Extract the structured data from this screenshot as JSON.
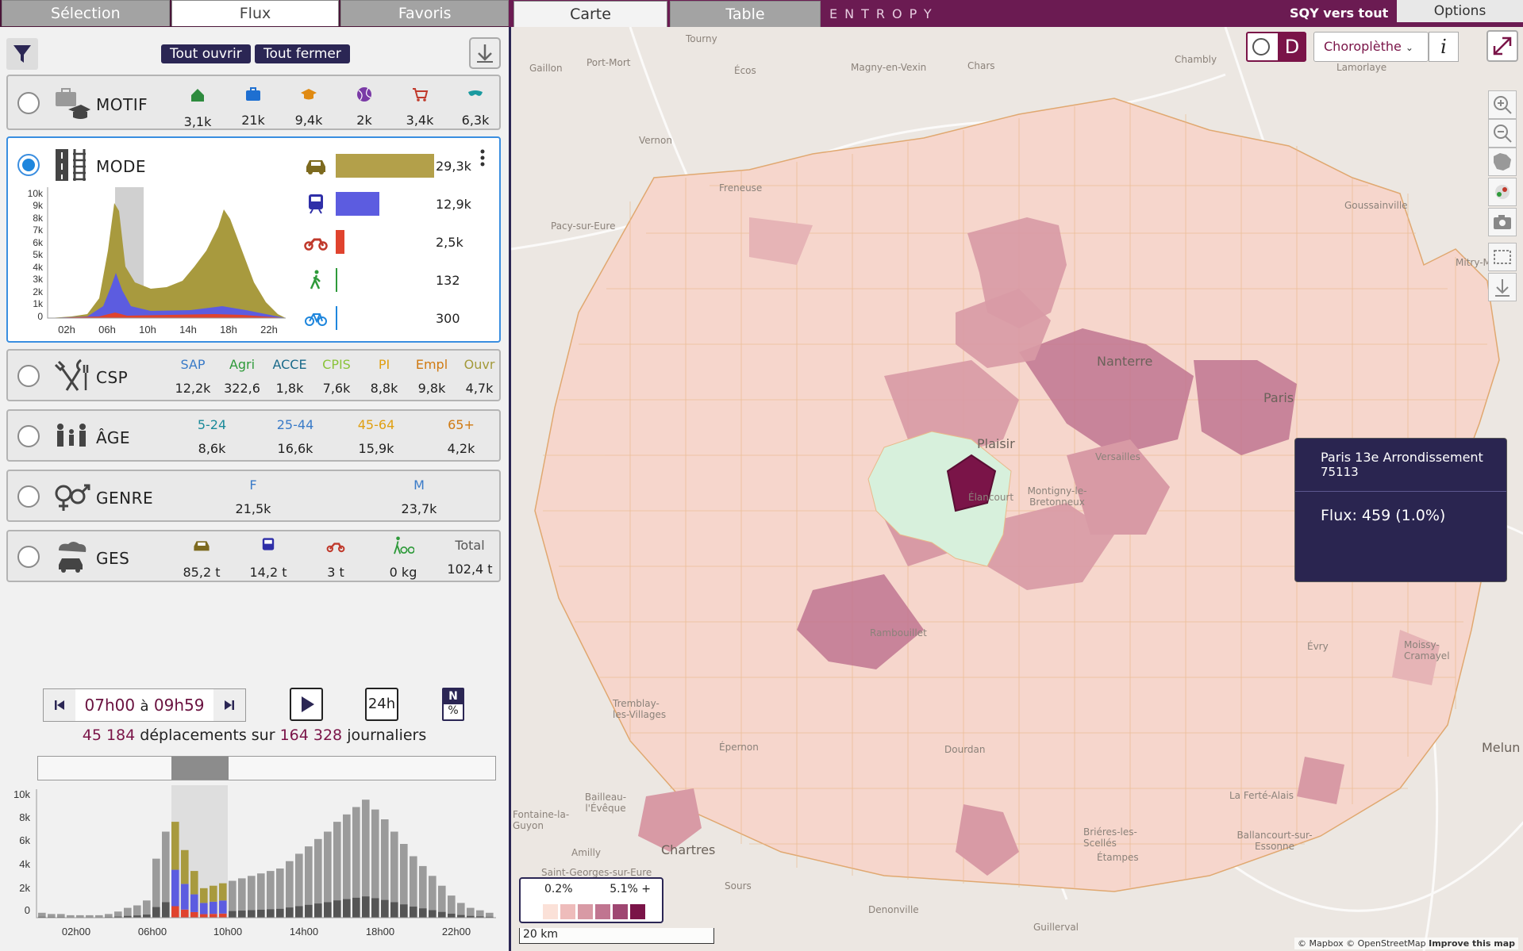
{
  "left_tabs": [
    "Sélection",
    "Flux",
    "Favoris"
  ],
  "buttons": {
    "open_all": "Tout ouvrir",
    "close_all": "Tout fermer"
  },
  "motif": {
    "title": "MOTIF",
    "items": [
      {
        "icon": "home-icon",
        "value": "3,1k",
        "color": "#2e8b3e"
      },
      {
        "icon": "briefcase-icon",
        "value": "21k",
        "color": "#1e6fd1"
      },
      {
        "icon": "graduation-cap-icon",
        "value": "9,4k",
        "color": "#e08a12"
      },
      {
        "icon": "ball-icon",
        "value": "2k",
        "color": "#7a3aa6"
      },
      {
        "icon": "shopping-cart-icon",
        "value": "3,4k",
        "color": "#c0392b"
      },
      {
        "icon": "mask-icon",
        "value": "6,3k",
        "color": "#1a9aa0"
      }
    ]
  },
  "mode": {
    "title": "MODE",
    "rows": [
      {
        "icon": "car-icon",
        "value": "29,3k",
        "fraction": 1.0,
        "color": "#b3a04a"
      },
      {
        "icon": "train-icon",
        "value": "12,9k",
        "fraction": 0.44,
        "color": "#5c5ce0"
      },
      {
        "icon": "motorbike-icon",
        "value": "2,5k",
        "fraction": 0.085,
        "color": "#e0432e"
      },
      {
        "icon": "pedestrian-icon",
        "value": "132",
        "fraction": 0.005,
        "color": "#2e9a3a"
      },
      {
        "icon": "bicycle-icon",
        "value": "300",
        "fraction": 0.01,
        "color": "#1e86dd"
      }
    ],
    "chart": {
      "y_ticks": [
        "10k",
        "9k",
        "8k",
        "7k",
        "6k",
        "5k",
        "4k",
        "3k",
        "2k",
        "1k",
        "0"
      ],
      "x_ticks": [
        "02h",
        "06h",
        "10h",
        "14h",
        "18h",
        "22h"
      ]
    }
  },
  "csp": {
    "title": "CSP",
    "items": [
      {
        "label": "SAP",
        "value": "12,2k",
        "color": "#3a7bc8"
      },
      {
        "label": "Agri",
        "value": "322,6",
        "color": "#2e9a3a"
      },
      {
        "label": "ACCE",
        "value": "1,8k",
        "color": "#1a6a8a"
      },
      {
        "label": "CPIS",
        "value": "7,6k",
        "color": "#8ac33a"
      },
      {
        "label": "PI",
        "value": "8,8k",
        "color": "#e0a012"
      },
      {
        "label": "Empl",
        "value": "9,8k",
        "color": "#d07a12"
      },
      {
        "label": "Ouvr",
        "value": "4,7k",
        "color": "#a39a3a"
      }
    ]
  },
  "age": {
    "title": "ÂGE",
    "items": [
      {
        "label": "5-24",
        "value": "8,6k",
        "color": "#1a8a9a"
      },
      {
        "label": "25-44",
        "value": "16,6k",
        "color": "#3a7bc8"
      },
      {
        "label": "45-64",
        "value": "15,9k",
        "color": "#e0a012"
      },
      {
        "label": "65+",
        "value": "4,2k",
        "color": "#d07a12"
      }
    ]
  },
  "genre": {
    "title": "GENRE",
    "items": [
      {
        "label": "F",
        "value": "21,5k",
        "color": "#3a7bc8"
      },
      {
        "label": "M",
        "value": "23,7k",
        "color": "#3a7bc8"
      }
    ]
  },
  "ges": {
    "title": "GES",
    "items": [
      {
        "icon": "car-icon",
        "value": "85,2 t"
      },
      {
        "icon": "train-icon",
        "value": "14,2 t"
      },
      {
        "icon": "motorbike-icon",
        "value": "3 t"
      },
      {
        "icon": "pedestrian-bicycle-icon",
        "value": "0 kg"
      },
      {
        "label": "Total",
        "value": "102,4 t"
      }
    ]
  },
  "time": {
    "from": "07h00",
    "sep": "à",
    "to": "09h59",
    "h24": "24h",
    "n": "N",
    "pct": "%"
  },
  "summary": {
    "count": "45 184",
    "mid": "déplacements sur",
    "total": "164 328",
    "end": "journaliers"
  },
  "hist": {
    "y_ticks": [
      "10k",
      "8k",
      "6k",
      "4k",
      "2k",
      "0"
    ],
    "x_ticks": [
      "02h00",
      "06h00",
      "10h00",
      "14h00",
      "18h00",
      "22h00"
    ]
  },
  "right_tabs": {
    "carte": "Carte",
    "table": "Table"
  },
  "brand": "ENTROPY",
  "sqy": "SQY vers tout",
  "options": "Options",
  "map_controls": {
    "o": "O",
    "d": "D",
    "mode": "Choroplèthe",
    "info": "i"
  },
  "tooltip": {
    "name": "Paris 13e Arrondissement",
    "code": "75113",
    "flux": "Flux: 459 (1.0%)"
  },
  "legend": {
    "min": "0.2%",
    "max": "5.1% +",
    "colors": [
      "#fbe1d8",
      "#eebcbb",
      "#d89aa5",
      "#c07590",
      "#9f4772",
      "#7a1448"
    ]
  },
  "scale": "20 km",
  "attribution": {
    "a": "© Mapbox © OpenStreetMap",
    "b": "Improve this map"
  },
  "places": [
    {
      "n": "Tourny"
    },
    {
      "n": "Port-Mort"
    },
    {
      "n": "Gaillon"
    },
    {
      "n": "Écos"
    },
    {
      "n": "Magny-en-Vexin"
    },
    {
      "n": "Chars"
    },
    {
      "n": "Chambly"
    },
    {
      "n": "Lamorlaye"
    },
    {
      "n": "Vernon"
    },
    {
      "n": "Freneuse"
    },
    {
      "n": "Pacy-sur-Eure"
    },
    {
      "n": "Goussainville"
    },
    {
      "n": "Mitry-Mo"
    },
    {
      "n": "Nanterre"
    },
    {
      "n": "Paris"
    },
    {
      "n": "Plaisir"
    },
    {
      "n": "Élancourt"
    },
    {
      "n": "Montigny-le-Bretonneux"
    },
    {
      "n": "Versailles"
    },
    {
      "n": "Rambouillet"
    },
    {
      "n": "Évry"
    },
    {
      "n": "Moissy-Cramayel"
    },
    {
      "n": "Melun"
    },
    {
      "n": "Chartres"
    },
    {
      "n": "Épernon"
    },
    {
      "n": "Dourdan"
    },
    {
      "n": "Étampes"
    },
    {
      "n": "Ballancourt-sur-Essonne"
    },
    {
      "n": "Bailleau-l'Évêque"
    },
    {
      "n": "Fontaine-la-Guyon"
    },
    {
      "n": "Saint-Georges-sur-Eure"
    },
    {
      "n": "Amilly"
    },
    {
      "n": "Sours"
    },
    {
      "n": "Denonville"
    },
    {
      "n": "Guillerval"
    },
    {
      "n": "Briéres-les-Scellés"
    },
    {
      "n": "La Ferté-Alais"
    },
    {
      "n": "Tremblay-les-Villages"
    }
  ]
}
